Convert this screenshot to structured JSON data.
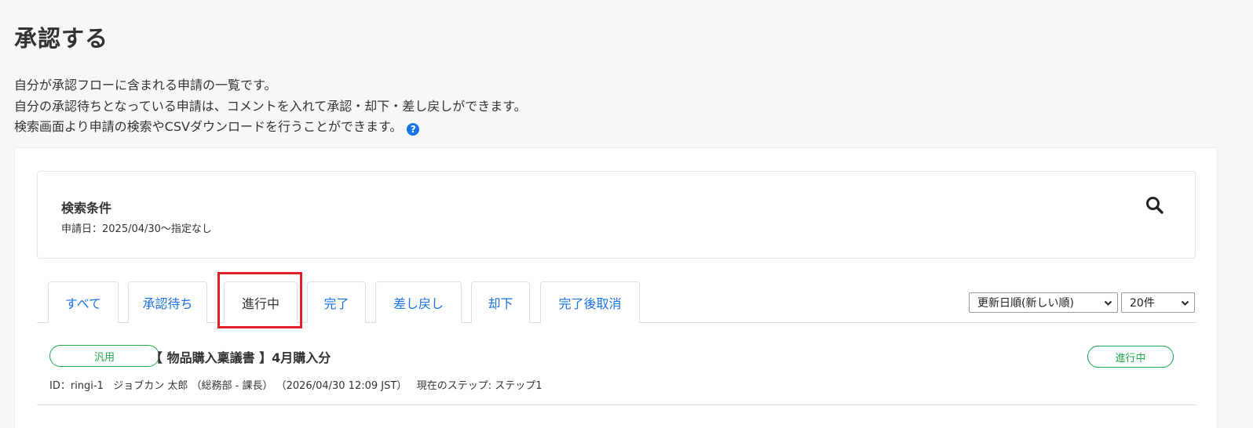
{
  "page": {
    "title": "承認する",
    "description": [
      "自分が承認フローに含まれる申請の一覧です。",
      "自分の承認待ちとなっている申請は、コメントを入れて承認・却下・差し戻しができます。",
      "検索画面より申請の検索やCSVダウンロードを行うことができます。"
    ],
    "help_icon": "question-circle-icon"
  },
  "search": {
    "title": "検索条件",
    "condition": "申請日：2025/04/30〜指定なし",
    "icon": "search-icon"
  },
  "tabs": [
    {
      "label": "すべて",
      "active": false
    },
    {
      "label": "承認待ち",
      "active": false
    },
    {
      "label": "進行中",
      "active": true
    },
    {
      "label": "完了",
      "active": false
    },
    {
      "label": "差し戻し",
      "active": false
    },
    {
      "label": "却下",
      "active": false
    },
    {
      "label": "完了後取消",
      "active": false
    }
  ],
  "sort": {
    "selected": "更新日順(新しい順)"
  },
  "per_page": {
    "selected": "20件"
  },
  "requests": [
    {
      "type_badge": "汎用",
      "title": "【 物品購入稟議書 】4月購入分",
      "meta": "ID：ringi-1   ジョブカン 太郎 （総務部 - 課長） （2026/04/30 12:09 JST）   現在のステップ: ステップ1",
      "status_badge": "進行中"
    }
  ],
  "colors": {
    "link": "#1a73e8",
    "status_green": "#1fa84a",
    "highlight_red": "#e0202a",
    "background": "#f7f7f6"
  }
}
